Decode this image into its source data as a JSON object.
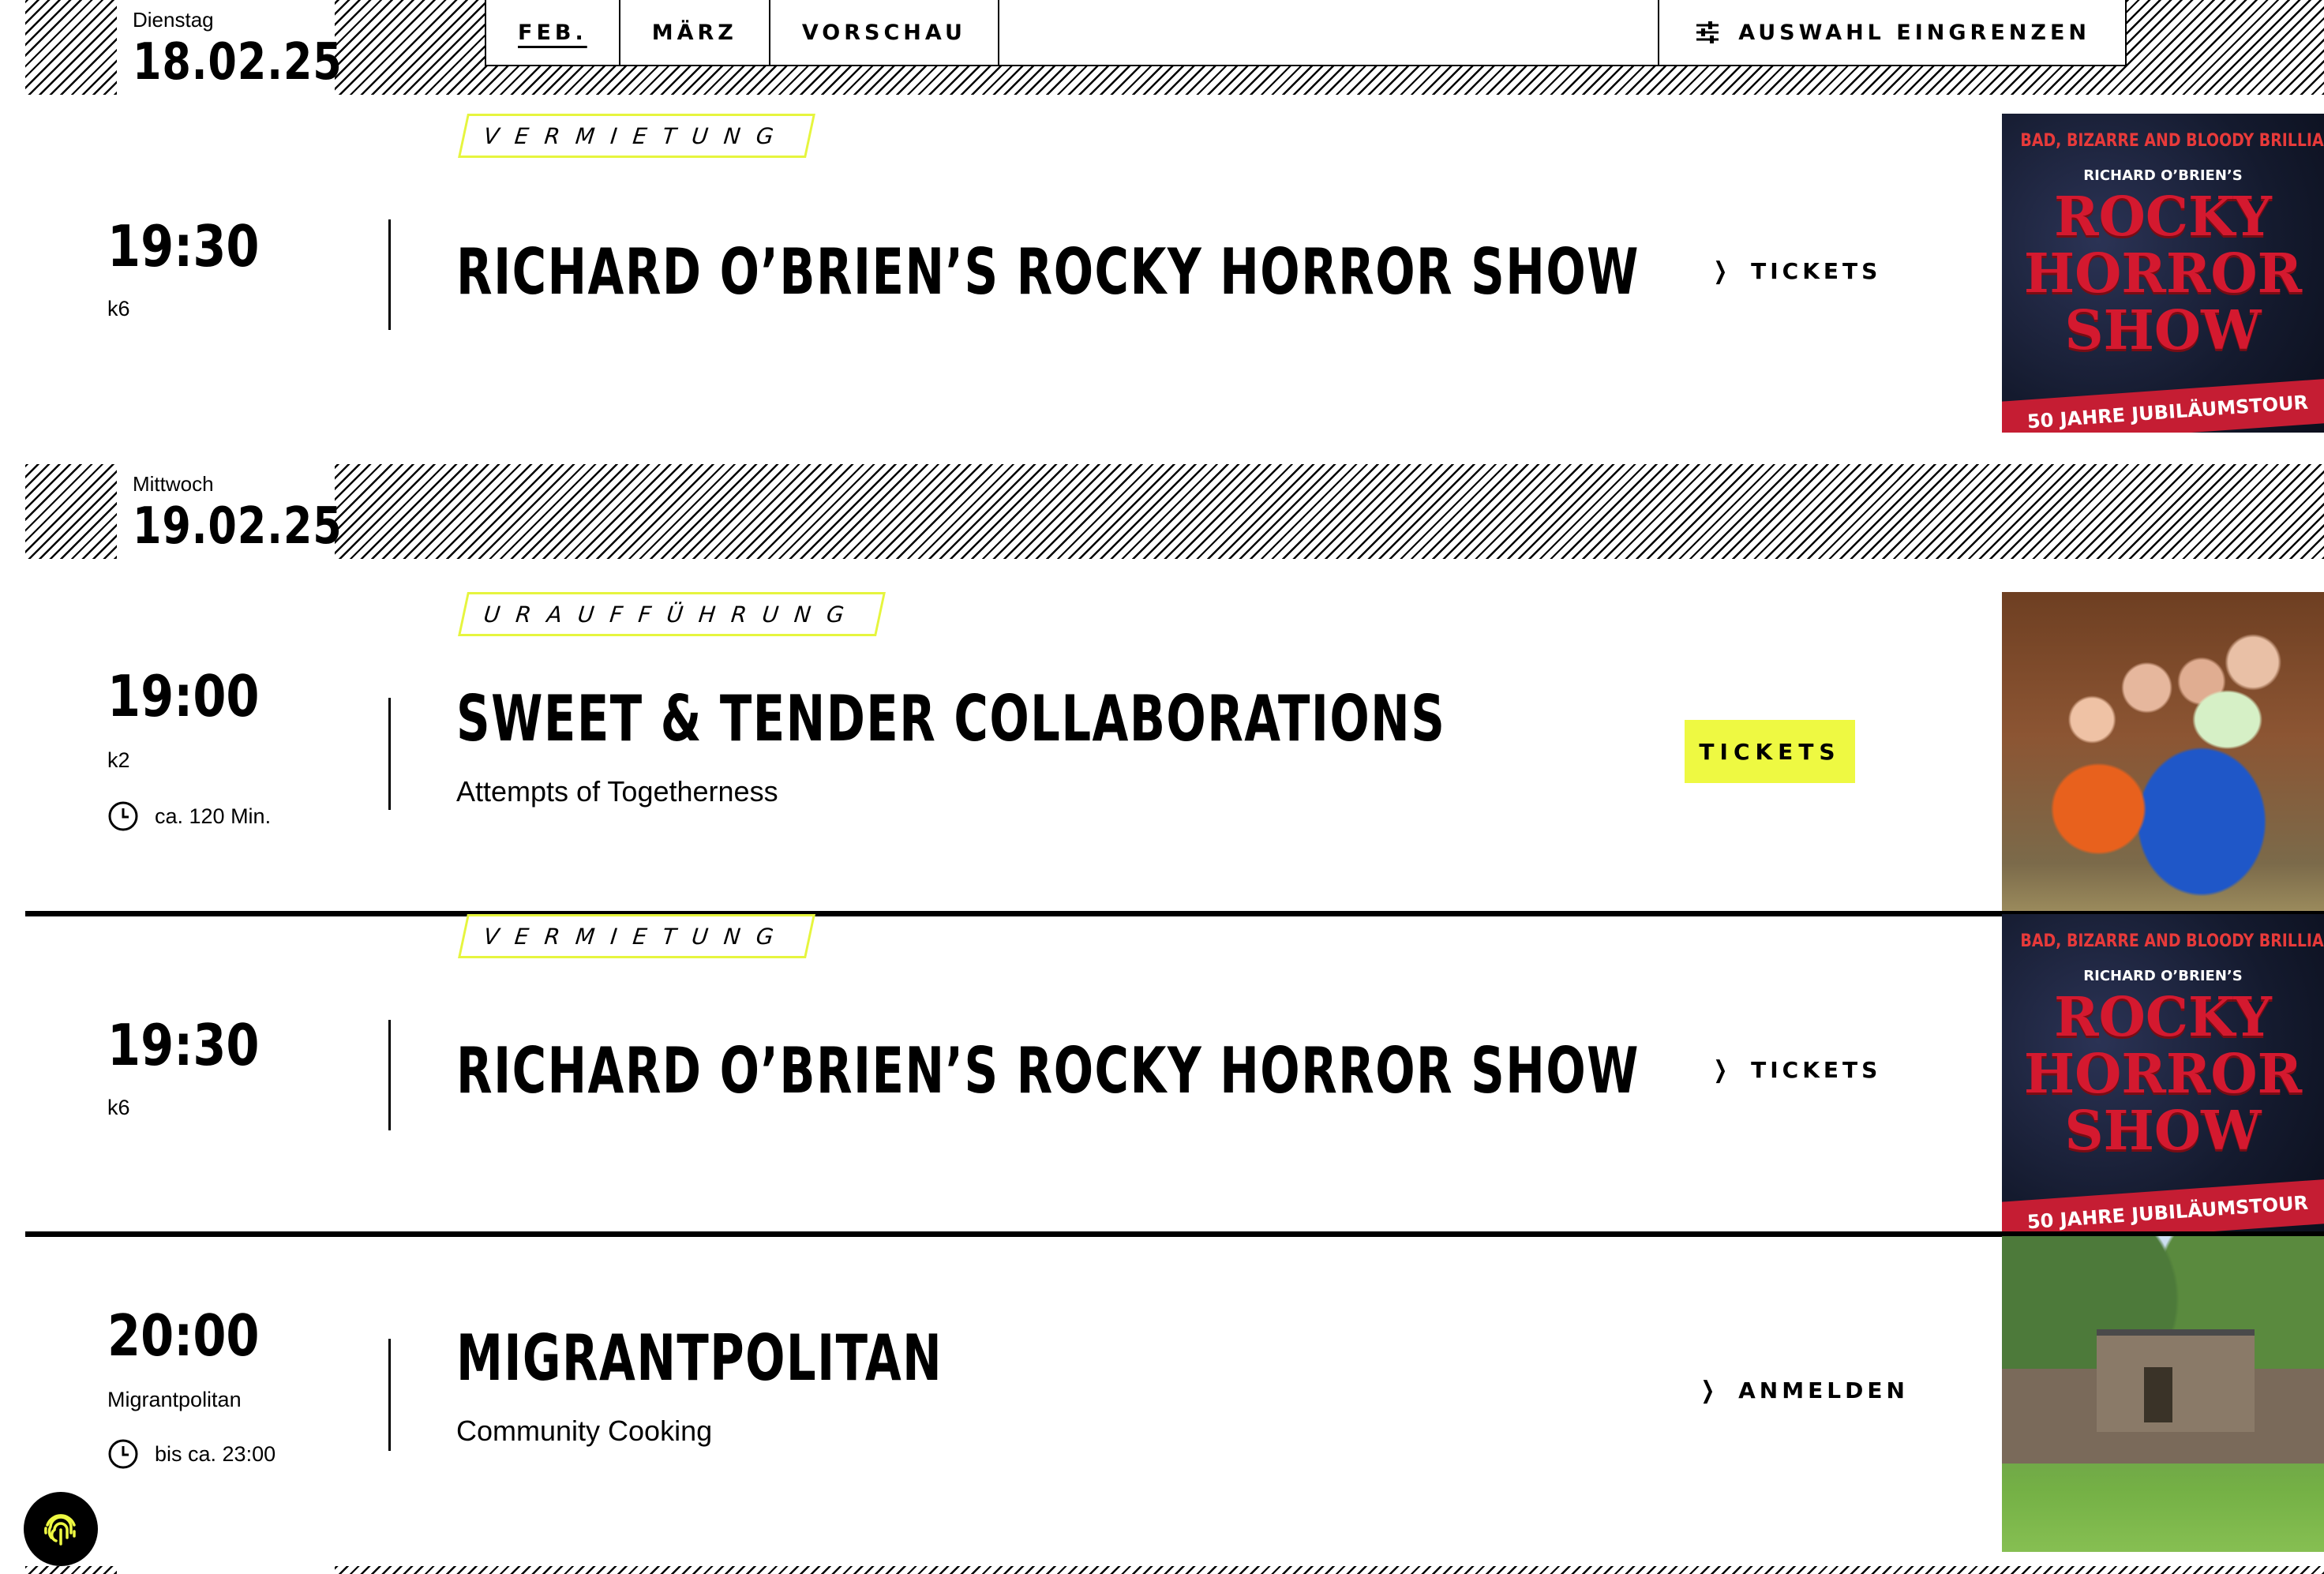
{
  "nav": {
    "items": [
      {
        "label": "FEB.",
        "active": true
      },
      {
        "label": "MÄRZ",
        "active": false
      },
      {
        "label": "VORSCHAU",
        "active": false
      }
    ],
    "filter_label": "AUSWAHL EINGRENZEN",
    "filter_icon": "sliders-icon"
  },
  "days": [
    {
      "weekday": "Dienstag",
      "date": "18.02.25"
    },
    {
      "weekday": "Mittwoch",
      "date": "19.02.25"
    }
  ],
  "events": [
    {
      "tag": "VERMIETUNG",
      "time": "19:30",
      "venue": "k6",
      "title": "RICHARD O’BRIEN’S ROCKY HORROR SHOW",
      "action": "TICKETS",
      "action_style": "link"
    },
    {
      "tag": "URAUFFÜHRUNG",
      "time": "19:00",
      "venue": "k2",
      "duration": "ca. 120 Min.",
      "title": "SWEET & TENDER COLLABORATIONS",
      "subtitle": "Attempts of Togetherness",
      "action": "TICKETS",
      "action_style": "button"
    },
    {
      "tag": "VERMIETUNG",
      "time": "19:30",
      "venue": "k6",
      "title": "RICHARD O’BRIEN’S ROCKY HORROR SHOW",
      "action": "TICKETS",
      "action_style": "link"
    },
    {
      "time": "20:00",
      "venue": "Migrantpolitan",
      "duration": "bis ca. 23:00",
      "title": "MIGRANTPOLITAN",
      "subtitle": "Community Cooking",
      "action": "ANMELDEN",
      "action_style": "link"
    }
  ],
  "poster": {
    "tagline": "BAD, BIZARRE AND BLOODY BRILLIANT!",
    "presenter": "RICHARD O’BRIEN’S",
    "words": [
      "ROCKY",
      "HORROR",
      "SHOW"
    ],
    "band": "50 JAHRE JUBILÄUMSTOUR"
  },
  "colors": {
    "accent_yellow": "#eef942",
    "tag_border": "#e6f53e",
    "text": "#000000",
    "background": "#ffffff"
  }
}
